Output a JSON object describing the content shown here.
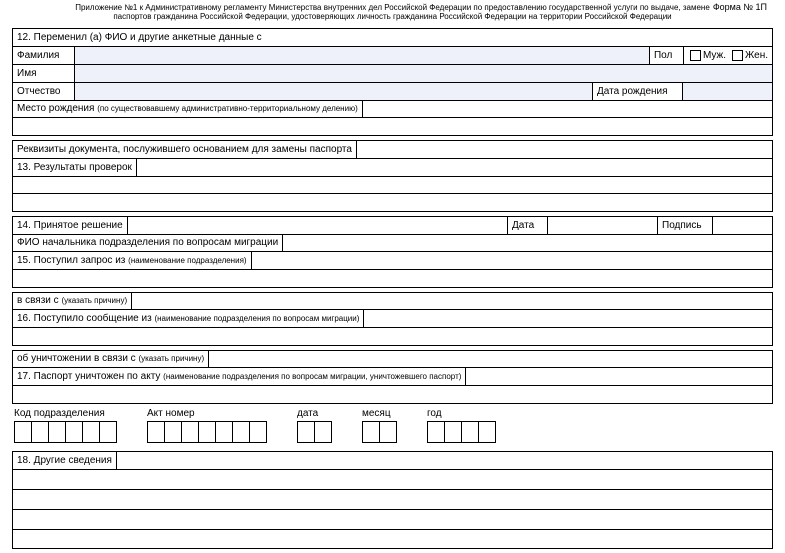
{
  "header": {
    "line1": "Приложение №1 к Административному регламенту Министерства внутренних дел Российской Федерации по предоставлению государственной услуги по выдаче, замене",
    "line2": "паспортов гражданина Российской Федерации, удостоверяющих личность гражданина Российской Федерации на территории Российской Федерации",
    "form_number": "Форма № 1П"
  },
  "section12": {
    "title": "12. Переменил (а) ФИО и другие анкетные данные с",
    "surname_label": "Фамилия",
    "name_label": "Имя",
    "patronymic_label": "Отчество",
    "sex_label": "Пол",
    "sex_m": "Муж.",
    "sex_f": "Жен.",
    "dob_label": "Дата рождения",
    "birthplace_label": "Место рождения",
    "birthplace_hint": "(по существовавшему административно-территориальному делению)",
    "doc_basis_label": "Реквизиты документа, послужившего основанием для замены паспорта"
  },
  "section13": {
    "title": "13. Результаты проверок"
  },
  "section14": {
    "title": "14. Принятое решение",
    "date_label": "Дата",
    "sign_label": "Подпись",
    "chief_label": "ФИО начальника подразделения по вопросам миграции"
  },
  "section15": {
    "title": "15. Поступил запрос из",
    "title_hint": "(наименование подразделения)",
    "reason_label": "в связи с",
    "reason_hint": "(указать причину)"
  },
  "section16": {
    "title": "16. Поступило сообщение из",
    "title_hint": "(наименование подразделения по вопросам миграции)",
    "destroy_label": "об уничтожении в связи с",
    "destroy_hint": "(указать причину)"
  },
  "section17": {
    "title": "17. Паспорт уничтожен по акту",
    "title_hint": "(наименование подразделения по вопросам миграции, уничтожевшего паспорт)"
  },
  "codes": {
    "dept_code_label": "Код подразделения",
    "act_label": "Акт номер",
    "date_label": "дата",
    "month_label": "месяц",
    "year_label": "год"
  },
  "section18": {
    "title": "18. Другие сведения"
  }
}
